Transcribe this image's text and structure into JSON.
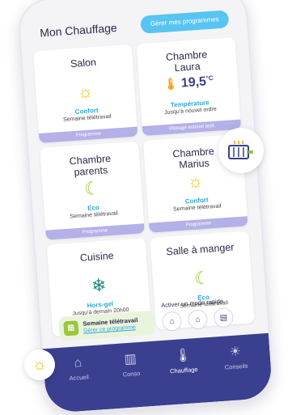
{
  "header": {
    "title": "Mon Chauffage",
    "manage_button": "Gérer mes programmes"
  },
  "rooms": [
    {
      "name": "Salon",
      "icon": "sun-icon",
      "mode": "Confort",
      "schedule": "Semaine télétravail",
      "pill": "Programme"
    },
    {
      "name": "Chambre Laura",
      "icon": "thermometer-icon",
      "temperature": "19,5",
      "unit": "°C",
      "mode": "Température",
      "schedule": "Jusqu'à nouvel ordre",
      "pill": "Pilotage manuel actif"
    },
    {
      "name": "Chambre parents",
      "icon": "moon-icon",
      "mode": "Eco",
      "schedule": "Semaine télétravail",
      "pill": "Programme"
    },
    {
      "name": "Chambre Marius",
      "icon": "sun-icon",
      "mode": "Confort",
      "schedule": "Semaine télétravail",
      "pill": "Programme"
    },
    {
      "name": "Cuisine",
      "icon": "snowflake-icon",
      "mode": "Hors-gel",
      "schedule": "Jusqu'à demain 20h00",
      "pill": ""
    },
    {
      "name": "Salle à manger",
      "icon": "moon-icon",
      "mode": "Eco",
      "schedule": "Semaine télétravail",
      "pill": ""
    }
  ],
  "program": {
    "name": "Semaine télétravail",
    "link": "Gérer ce programme"
  },
  "quick_mode": {
    "label": "Activer un mode rapide"
  },
  "nav": [
    {
      "label": "Accueil",
      "icon": "home-icon"
    },
    {
      "label": "Conso",
      "icon": "chart-icon"
    },
    {
      "label": "Chauffage",
      "icon": "thermometer-icon"
    },
    {
      "label": "Conseils",
      "icon": "bulb-icon"
    }
  ]
}
